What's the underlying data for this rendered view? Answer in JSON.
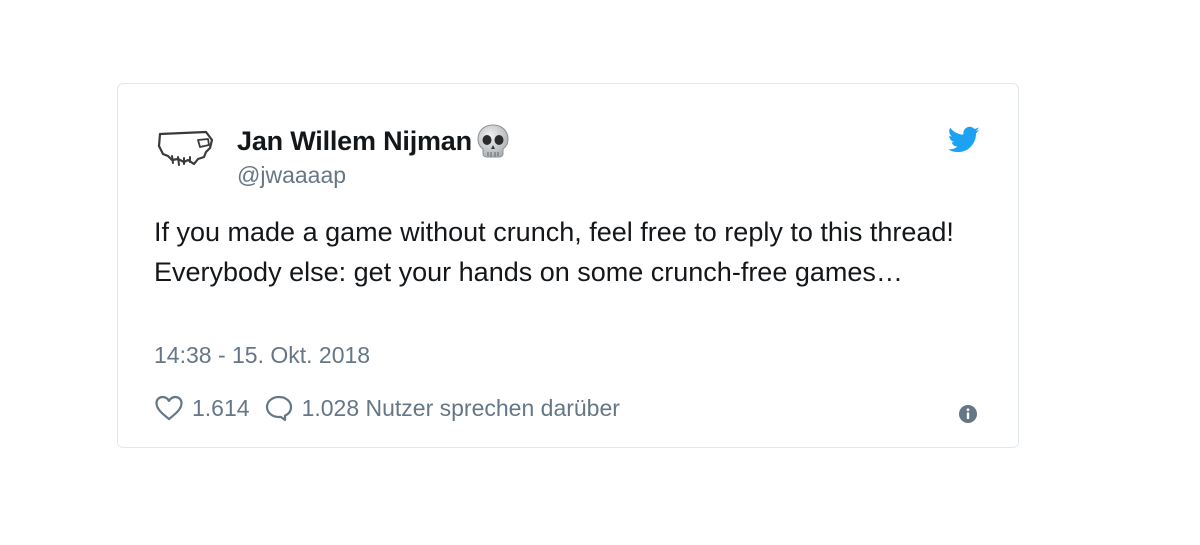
{
  "tweet": {
    "author": {
      "display_name": "Jan Willem Nijman",
      "handle": "@jwaaaap",
      "name_emoji": "skull-icon",
      "avatar": "avatar-icon"
    },
    "text": "If you made a game without crunch, feel free to reply to this thread! Everybody else: get your hands on some crunch-free games…",
    "timestamp": "14:38 - 15. Okt. 2018",
    "likes": "1.614",
    "replies_label": "1.028 Nutzer sprechen darüber",
    "icons": {
      "brand": "twitter-bird-icon",
      "like": "heart-icon",
      "reply": "speech-bubble-icon",
      "info": "info-icon"
    }
  },
  "colors": {
    "text_primary": "#14171a",
    "text_secondary": "#657786",
    "twitter_blue": "#1da1f2",
    "card_border": "#e1e8ed"
  }
}
